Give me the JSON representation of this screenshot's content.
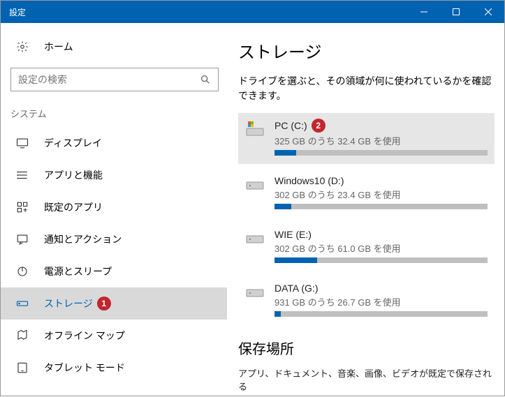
{
  "window": {
    "title": "設定"
  },
  "sidebar": {
    "home_label": "ホーム",
    "search_placeholder": "設定の検索",
    "category": "システム",
    "items": [
      {
        "label": "ディスプレイ",
        "icon": "display-icon"
      },
      {
        "label": "アプリと機能",
        "icon": "apps-icon"
      },
      {
        "label": "既定のアプリ",
        "icon": "defaults-icon"
      },
      {
        "label": "通知とアクション",
        "icon": "notifications-icon"
      },
      {
        "label": "電源とスリープ",
        "icon": "power-icon"
      },
      {
        "label": "ストレージ",
        "icon": "storage-icon"
      },
      {
        "label": "オフライン マップ",
        "icon": "map-icon"
      },
      {
        "label": "タブレット モード",
        "icon": "tablet-icon"
      }
    ],
    "selected_index": 5,
    "badge1": "1"
  },
  "main": {
    "heading": "ストレージ",
    "description": "ドライブを選ぶと、その領域が何に使われているかを確認できます。",
    "drives": [
      {
        "name": "PC (C:)",
        "sub": "325 GB のうち 32.4 GB を使用",
        "fill_pct": 10,
        "system": true,
        "highlighted": true,
        "badge": "2"
      },
      {
        "name": "Windows10 (D:)",
        "sub": "302 GB のうち 23.4 GB を使用",
        "fill_pct": 8,
        "system": false,
        "highlighted": false
      },
      {
        "name": "WIE (E:)",
        "sub": "302 GB のうち 61.0 GB を使用",
        "fill_pct": 20,
        "system": false,
        "highlighted": false
      },
      {
        "name": "DATA (G:)",
        "sub": "931 GB のうち 26.7 GB を使用",
        "fill_pct": 3,
        "system": false,
        "highlighted": false
      }
    ],
    "save_heading": "保存場所",
    "save_sub": "アプリ、ドキュメント、音楽、画像、ビデオが既定で保存される"
  }
}
